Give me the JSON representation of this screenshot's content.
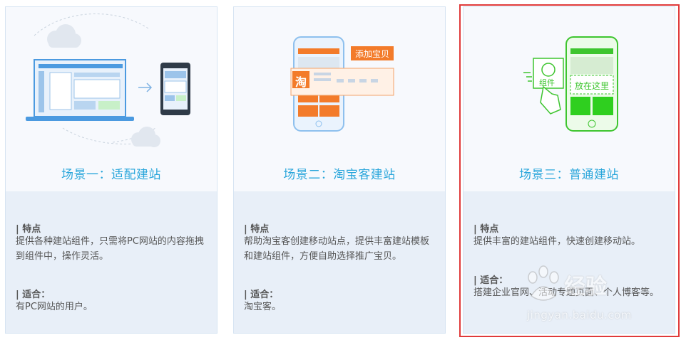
{
  "cards": [
    {
      "title": "场景一：适配建站",
      "feature_head": "| 特点",
      "feature_text": "提供各种建站组件，只需将PC网站的内容拖拽到组件中，操作灵活。",
      "fit_head": "| 适合：",
      "fit_text": "有PC网站的用户。"
    },
    {
      "title": "场景二：淘宝客建站",
      "feature_head": "| 特点",
      "feature_text": "帮助淘宝客创建移动站点，提供丰富建站模板和建站组件，方便自助选择推广宝贝。",
      "fit_head": "| 适合：",
      "fit_text": "淘宝客。",
      "illus_tag": "添加宝贝",
      "illus_logo": "淘"
    },
    {
      "title": "场景三：普通建站",
      "feature_head": "| 特点",
      "feature_text": "提供丰富的建站组件，快速创建移动站。",
      "fit_head": "| 适合：",
      "fit_text": "搭建企业官网、活动专题页面、个人博客等。",
      "illus_widget": "组件",
      "illus_drop": "放在这里"
    }
  ],
  "watermark": {
    "main": "经验",
    "sub": "jingyan.baidu.com"
  },
  "colors": {
    "title": "#2aa6db",
    "orange": "#f37b2a",
    "green": "#3ec52f",
    "blue": "#5aa7e8",
    "highlight": "#e03a3a"
  }
}
